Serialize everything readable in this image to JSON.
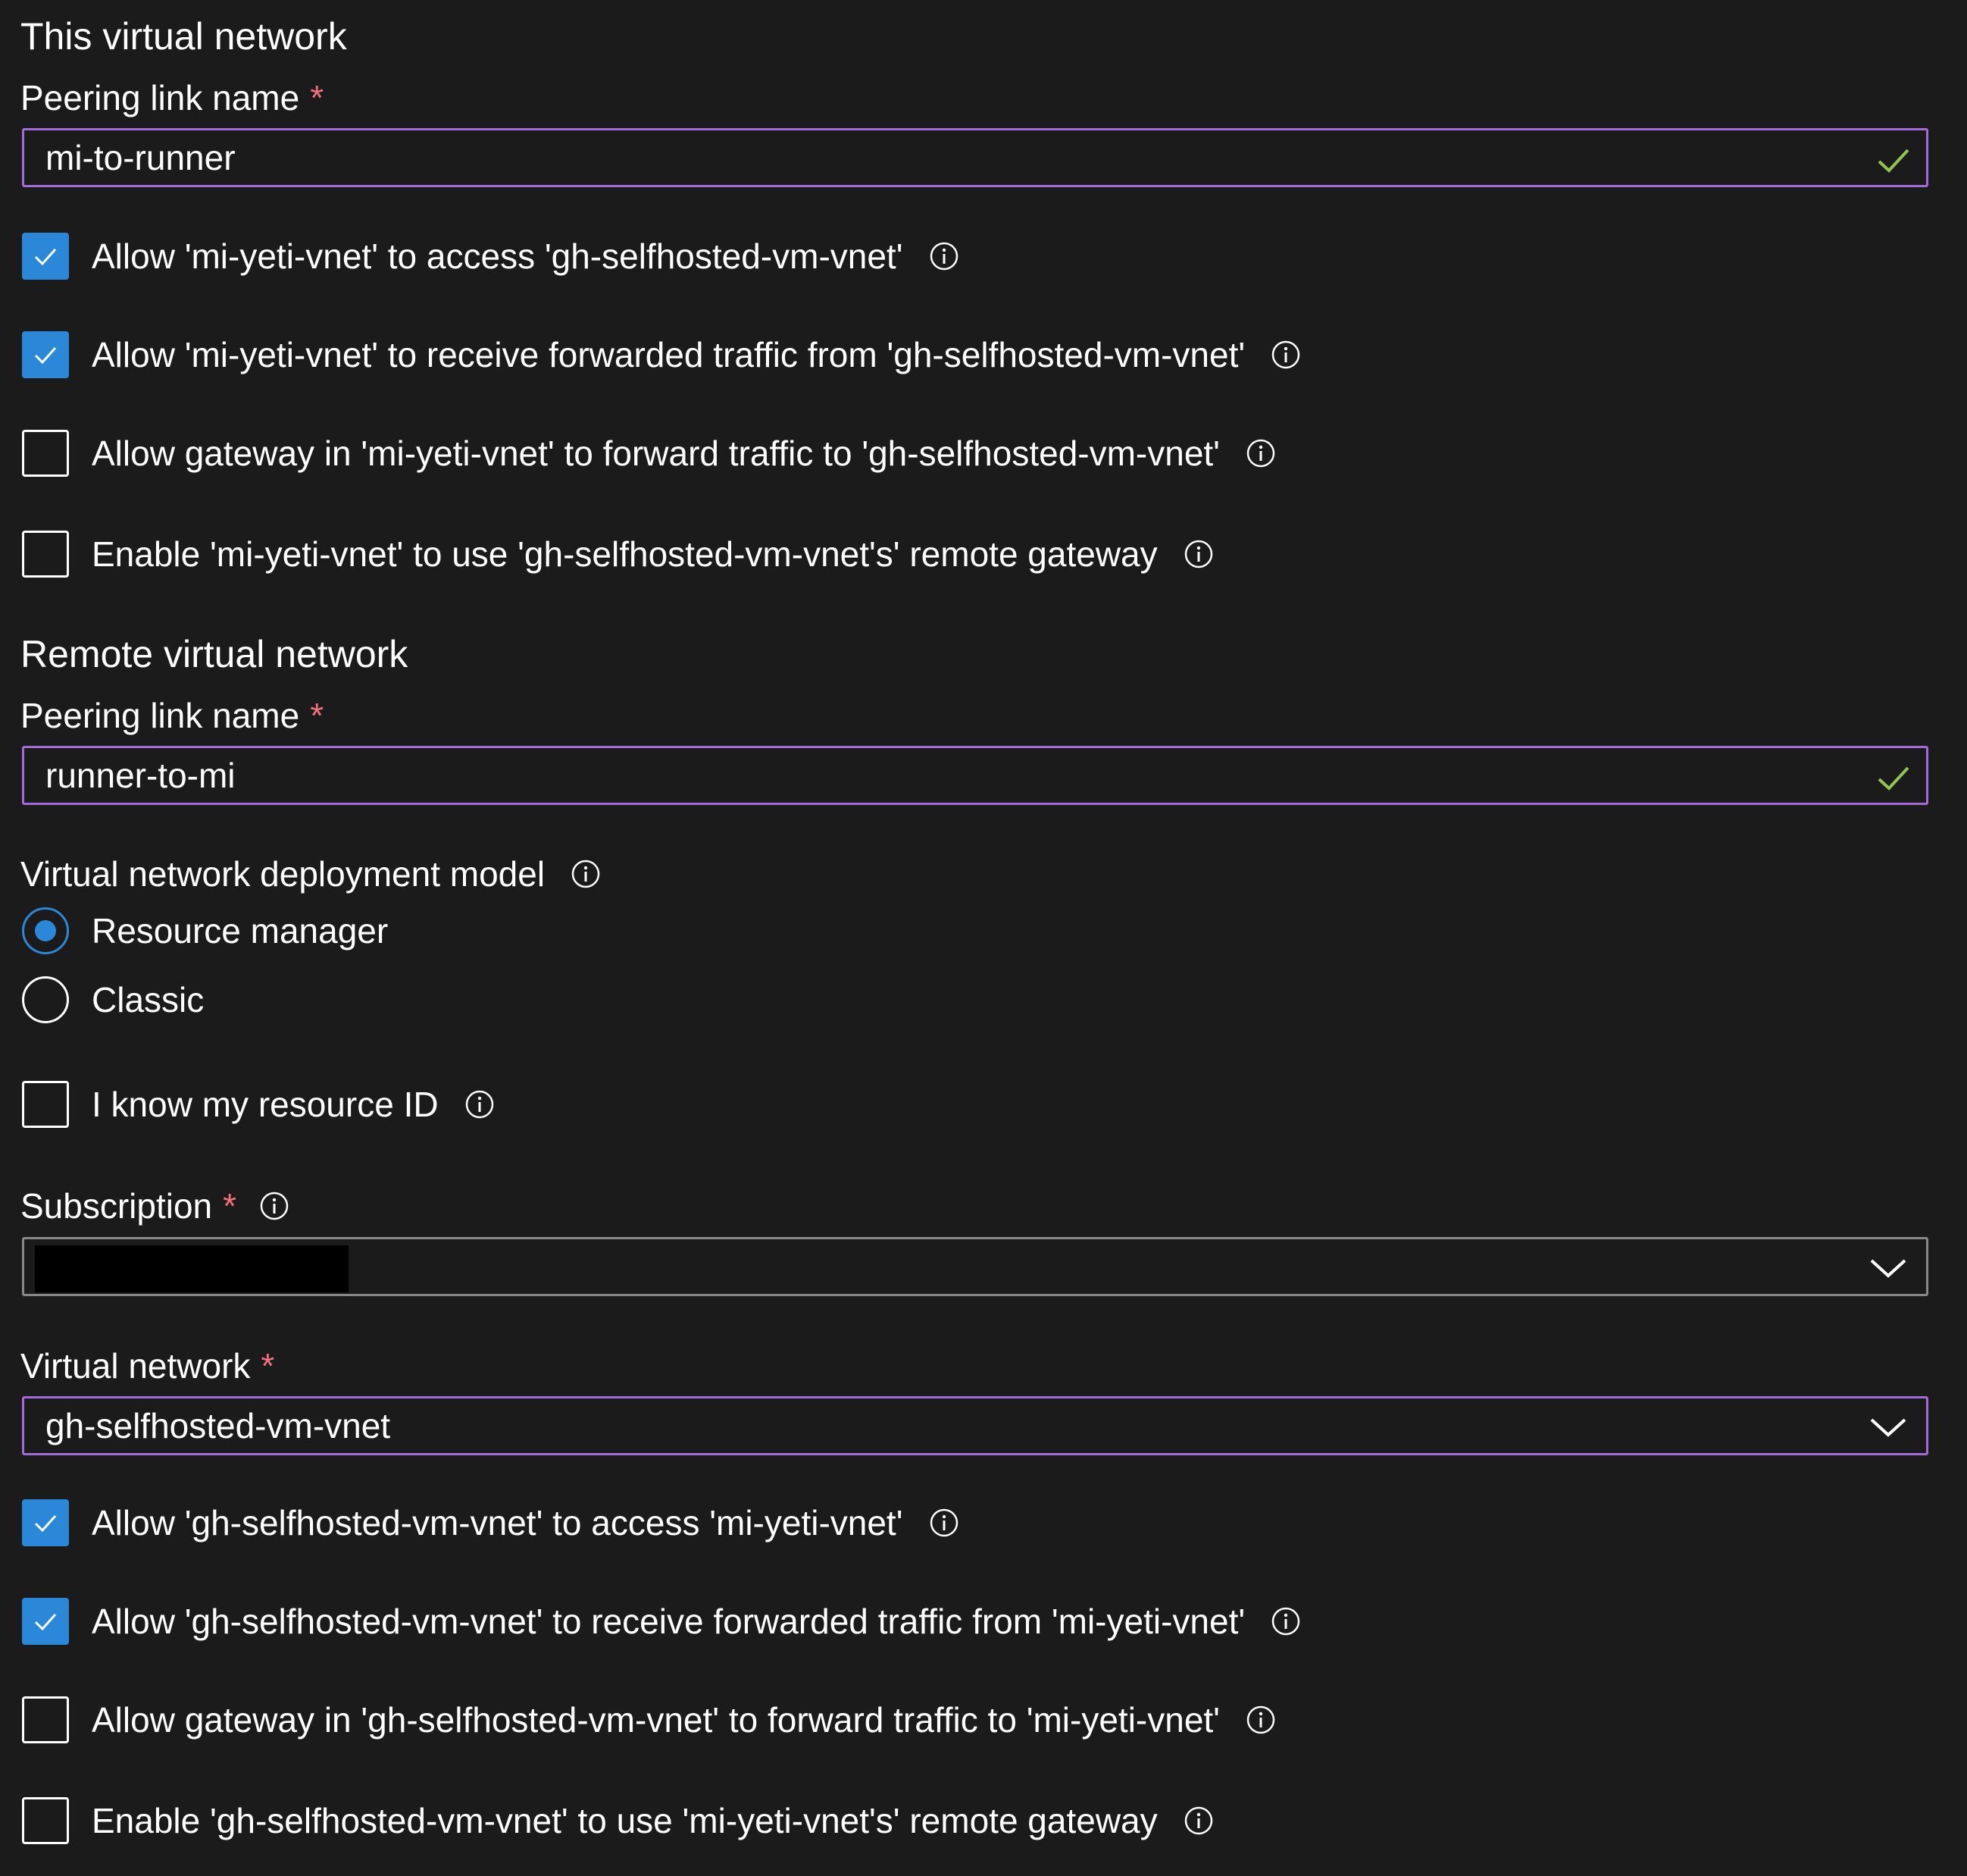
{
  "colors": {
    "background": "#1b1b1b",
    "text": "#ffffff",
    "required": "#f1707b",
    "focus_border": "#a46ad9",
    "checkbox_checked": "#2b88d8",
    "valid_check": "#92c353"
  },
  "this_vnet": {
    "heading": "This virtual network",
    "peering_label": "Peering link name",
    "peering_required": "*",
    "peering_value": "mi-to-runner",
    "options": [
      {
        "label": "Allow 'mi-yeti-vnet' to access 'gh-selfhosted-vm-vnet'",
        "checked": true
      },
      {
        "label": "Allow 'mi-yeti-vnet' to receive forwarded traffic from 'gh-selfhosted-vm-vnet'",
        "checked": true
      },
      {
        "label": "Allow gateway in 'mi-yeti-vnet' to forward traffic to 'gh-selfhosted-vm-vnet'",
        "checked": false
      },
      {
        "label": "Enable 'mi-yeti-vnet' to use 'gh-selfhosted-vm-vnet's' remote gateway",
        "checked": false
      }
    ]
  },
  "remote_vnet": {
    "heading": "Remote virtual network",
    "peering_label": "Peering link name",
    "peering_required": "*",
    "peering_value": "runner-to-mi",
    "deployment_model_label": "Virtual network deployment model",
    "deployment_models": [
      {
        "label": "Resource manager",
        "selected": true
      },
      {
        "label": "Classic",
        "selected": false
      }
    ],
    "know_resource_id_label": "I know my resource ID",
    "know_resource_id_checked": false,
    "subscription_label": "Subscription",
    "subscription_required": "*",
    "vnet_label": "Virtual network",
    "vnet_required": "*",
    "vnet_value": "gh-selfhosted-vm-vnet",
    "options": [
      {
        "label": "Allow 'gh-selfhosted-vm-vnet' to access 'mi-yeti-vnet'",
        "checked": true
      },
      {
        "label": "Allow 'gh-selfhosted-vm-vnet' to receive forwarded traffic from 'mi-yeti-vnet'",
        "checked": true
      },
      {
        "label": "Allow gateway in 'gh-selfhosted-vm-vnet' to forward traffic to 'mi-yeti-vnet'",
        "checked": false
      },
      {
        "label": "Enable 'gh-selfhosted-vm-vnet' to use 'mi-yeti-vnet's' remote gateway",
        "checked": false
      }
    ]
  },
  "icons": {
    "info": "info-icon",
    "valid": "checkmark-icon",
    "dropdown": "chevron-down-icon"
  }
}
